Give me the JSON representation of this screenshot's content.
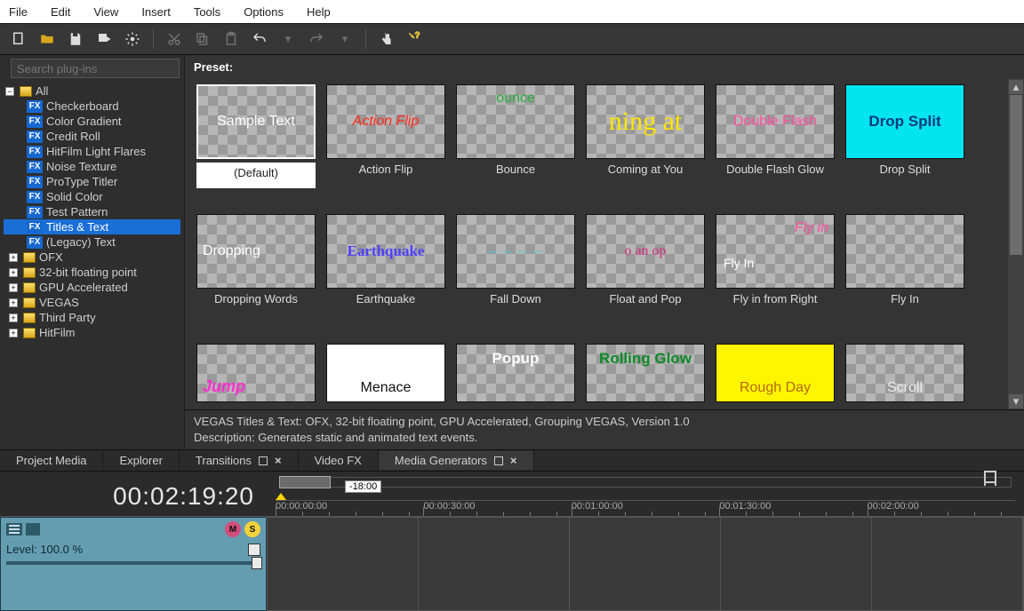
{
  "menu": {
    "items": [
      "File",
      "Edit",
      "View",
      "Insert",
      "Tools",
      "Options",
      "Help"
    ]
  },
  "search": {
    "placeholder": "Search plug-ins"
  },
  "tree": {
    "all": "All",
    "fx": [
      "Checkerboard",
      "Color Gradient",
      "Credit Roll",
      "HitFilm Light Flares",
      "Noise Texture",
      "ProType Titler",
      "Solid Color",
      "Test Pattern",
      "Titles & Text",
      "(Legacy) Text"
    ],
    "selected": "Titles & Text",
    "folders": [
      "OFX",
      "32-bit floating point",
      "GPU Accelerated",
      "VEGAS",
      "Third Party",
      "HitFilm"
    ]
  },
  "preset_label": "Preset:",
  "presets": [
    {
      "caption": "(Default)",
      "label": "Sample Text",
      "color": "#ffffff",
      "bg": "checker",
      "font": "normal",
      "selected": true
    },
    {
      "caption": "Action Flip",
      "label": "Action Flip",
      "color": "#ff2a1a",
      "bg": "checker",
      "font": "italic"
    },
    {
      "caption": "Bounce",
      "label": "ounce",
      "color": "#27b03b",
      "bg": "checker",
      "font": "normal",
      "align": "top"
    },
    {
      "caption": "Coming at You",
      "label": "ning at",
      "color": "#ffe600",
      "bg": "checker",
      "font": "serif-large"
    },
    {
      "caption": "Double Flash Glow",
      "label": "Double Flash",
      "color": "#ff4fa0",
      "bg": "checker",
      "font": "normal"
    },
    {
      "caption": "Drop Split",
      "label": "Drop Split",
      "color": "#003a7a",
      "bg": "#00e5f0",
      "font": "bold"
    },
    {
      "caption": "Dropping Words",
      "label": "Dropping",
      "color": "#ffffff",
      "bg": "checker",
      "font": "normal",
      "align": "left"
    },
    {
      "caption": "Earthquake",
      "label": "Earthquake",
      "color": "#5040ff",
      "bg": "checker",
      "font": "boldserif"
    },
    {
      "caption": "Fall Down",
      "label": "— — — —",
      "color": "#29d6e8",
      "bg": "checker",
      "font": "small"
    },
    {
      "caption": "Float and Pop",
      "label": "o  an  op",
      "color": "#d62f7b",
      "bg": "checker",
      "font": "serif"
    },
    {
      "caption": "Fly in from Right",
      "label": "Fly in",
      "color": "#ff4fa0",
      "bg": "checker",
      "font": "italic",
      "align": "topright",
      "extra": "Fly In",
      "extracolor": "#ffffff"
    },
    {
      "caption": "Fly In",
      "label": "",
      "color": "#ffffff",
      "bg": "checker",
      "font": "normal"
    },
    {
      "caption": "",
      "label": "Jump",
      "color": "#ff2fd0",
      "bg": "checker",
      "font": "bolditalic",
      "align": "bottomleft",
      "partial": true
    },
    {
      "caption": "",
      "label": "Menace",
      "color": "#111111",
      "bg": "#ffffff",
      "font": "normal",
      "align": "bottom",
      "partial": true
    },
    {
      "caption": "",
      "label": "Popup",
      "color": "#ffffff",
      "bg": "checker",
      "font": "bold",
      "align": "top",
      "partial": true
    },
    {
      "caption": "",
      "label": "Rolling Glow",
      "color": "#0d8a28",
      "bg": "checker",
      "font": "bold",
      "align": "top",
      "partial": true
    },
    {
      "caption": "",
      "label": "Rough Day",
      "color": "#b56a00",
      "bg": "#fff500",
      "font": "normal",
      "align": "bottom",
      "partial": true
    },
    {
      "caption": "",
      "label": "Scroll",
      "color": "#eeeeee",
      "bg": "checker",
      "font": "normal",
      "align": "bottom",
      "partial": true
    }
  ],
  "info": {
    "line1": "VEGAS Titles & Text: OFX, 32-bit floating point, GPU Accelerated, Grouping VEGAS, Version 1.0",
    "line2": "Description: Generates static and animated text events."
  },
  "tabs": [
    {
      "label": "Project Media",
      "close": false,
      "box": false
    },
    {
      "label": "Explorer",
      "close": false,
      "box": false
    },
    {
      "label": "Transitions",
      "close": true,
      "box": true
    },
    {
      "label": "Video FX",
      "close": false,
      "box": false
    },
    {
      "label": "Media Generators",
      "close": true,
      "box": true,
      "active": true
    }
  ],
  "timeline": {
    "timecode": "00:02:19:20",
    "scrub_label": "-18:00",
    "ruler": [
      "00:00:00:00",
      "00:00:30:00",
      "00:01:00:00",
      "00:01:30:00",
      "00:02:00:00"
    ],
    "track": {
      "level_label": "Level: 100.0 %"
    },
    "badges": [
      "M",
      "S"
    ]
  }
}
